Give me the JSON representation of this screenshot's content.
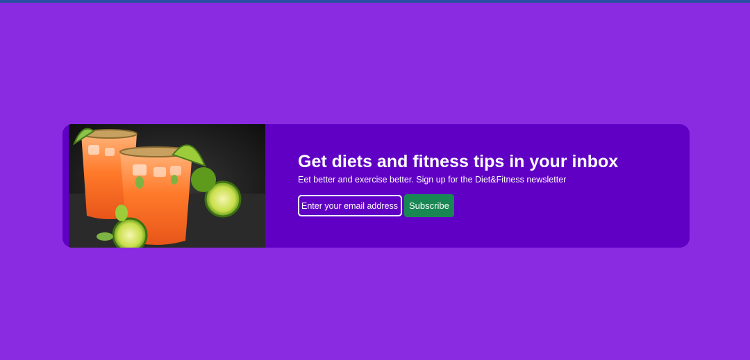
{
  "newsletter": {
    "headline": "Get diets and fitness tips in your inbox",
    "subtext": "Eet better and exercise better. Sign up for the Diet&Fitness newsletter",
    "email_placeholder": "Enter your email address",
    "subscribe_label": "Subscribe",
    "image_subject": "drinks-photo"
  },
  "colors": {
    "page_background": "#8a2be2",
    "top_bar": "#2b4fa0",
    "card_background": "#6000c4",
    "button_background": "#198754",
    "text": "#ffffff"
  }
}
